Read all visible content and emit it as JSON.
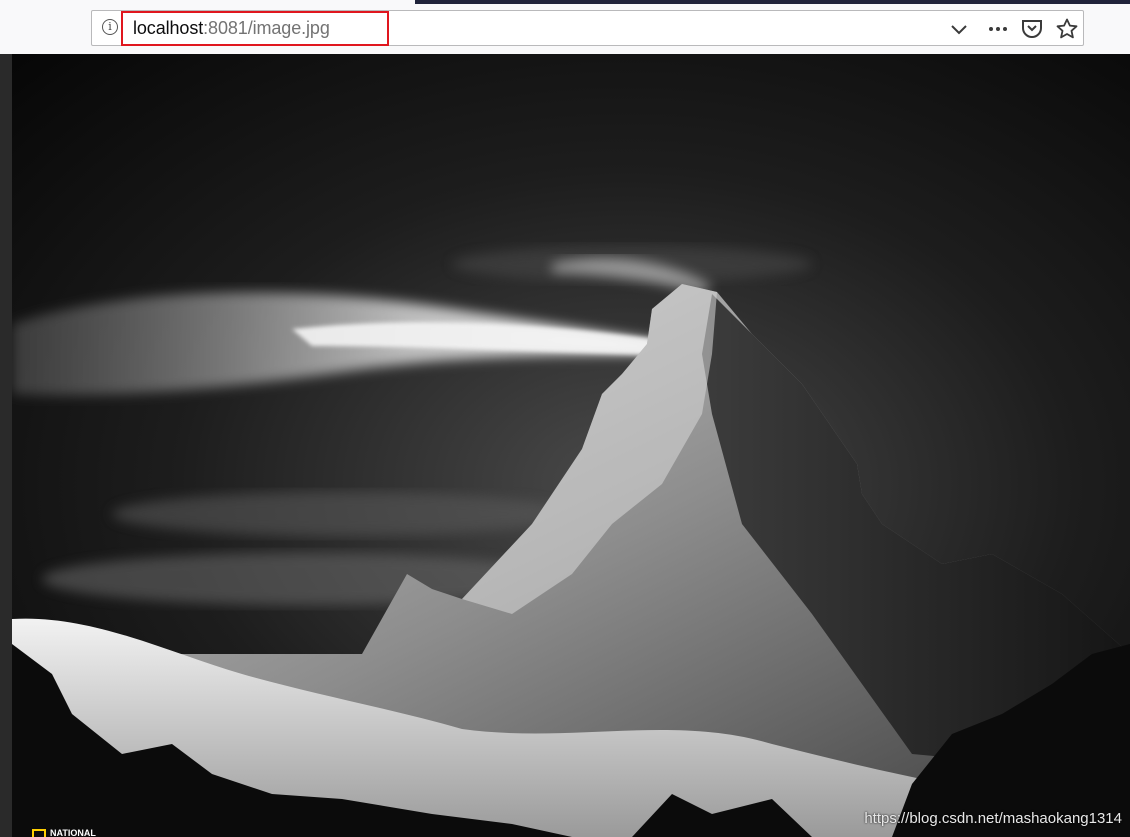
{
  "browser": {
    "url_host": "localhost",
    "url_rest": ":8081/image.jpg",
    "info_icon": "info-icon",
    "toolbar_icons": [
      "chevron-down-icon",
      "more-icon",
      "pocket-icon",
      "bookmark-star-icon"
    ]
  },
  "image": {
    "description_name": "matterhorn-night-photo",
    "watermark": "https://blog.csdn.net/mashaokang1314",
    "logo_text": "NATIONAL"
  },
  "colors": {
    "highlight_border": "#e0161e",
    "logo_yellow": "#ffcf00"
  }
}
